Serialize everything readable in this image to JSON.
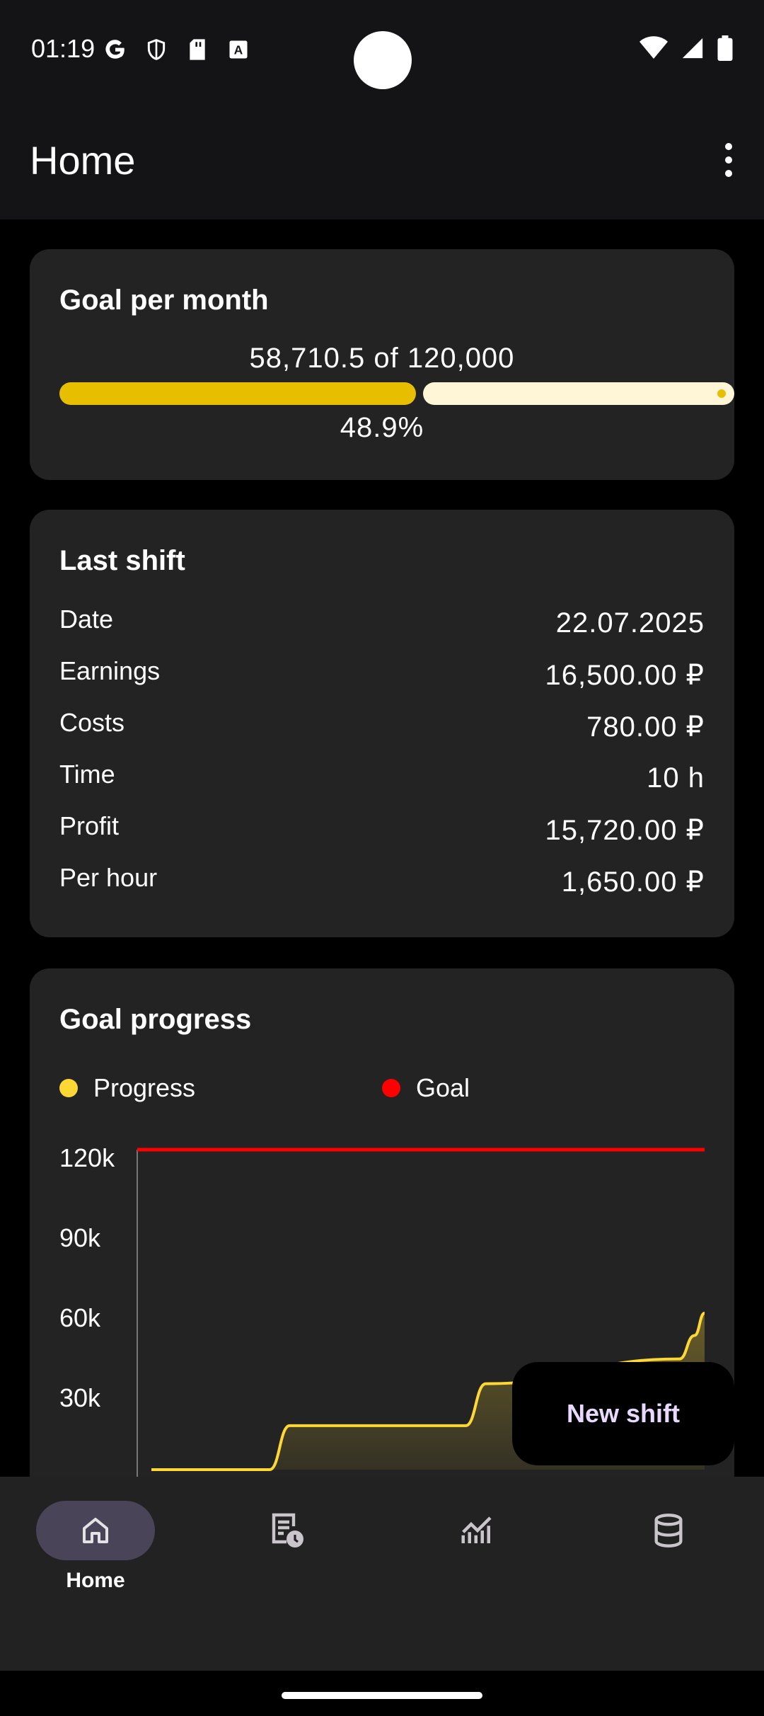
{
  "status_bar": {
    "time": "01:19",
    "left_icons": [
      "google-icon",
      "shield-icon",
      "sd-card-icon",
      "keyboard-a-icon"
    ],
    "right_icons": [
      "wifi-icon",
      "signal-icon",
      "battery-icon"
    ]
  },
  "app_bar": {
    "title": "Home",
    "menu_icon": "more-vert-icon"
  },
  "goal_card": {
    "title": "Goal per month",
    "amount_text": "58,710.5 of 120,000",
    "progress_fraction": 0.489,
    "percent_text": "48.9%",
    "colors": {
      "filled": "#e8bf00",
      "rest": "#fff6d7"
    }
  },
  "last_shift": {
    "title": "Last shift",
    "rows": [
      {
        "label": "Date",
        "value": "22.07.2025"
      },
      {
        "label": "Earnings",
        "value": "16,500.00 ₽"
      },
      {
        "label": "Costs",
        "value": "780.00 ₽"
      },
      {
        "label": "Time",
        "value": "10 h"
      },
      {
        "label": "Profit",
        "value": "15,720.00 ₽"
      },
      {
        "label": "Per hour",
        "value": "1,650.00 ₽"
      }
    ]
  },
  "goal_progress": {
    "title": "Goal progress",
    "legend": [
      {
        "label": "Progress",
        "color": "#fdd835"
      },
      {
        "label": "Goal",
        "color": "#ff0000"
      }
    ]
  },
  "chart_data": {
    "type": "line",
    "title": "Goal progress",
    "ylim": [
      0,
      120000
    ],
    "yticks": [
      120000,
      90000,
      60000,
      30000
    ],
    "ytick_labels": [
      "120k",
      "90k",
      "60k",
      "30k"
    ],
    "xlim": [
      0,
      22
    ],
    "grid": false,
    "legend_position": "top",
    "series": [
      {
        "name": "Progress",
        "color": "#fdd835",
        "fill": true,
        "x": [
          0,
          4.7,
          5.5,
          12.5,
          13.3,
          21.0,
          21.6,
          22.0
        ],
        "y": [
          0,
          0,
          16500,
          16500,
          32220,
          41500,
          50300,
          58710.5
        ]
      },
      {
        "name": "Goal",
        "color": "#ff0000",
        "x": [
          0,
          22
        ],
        "y": [
          120000,
          120000
        ]
      }
    ]
  },
  "fab": {
    "label": "New shift"
  },
  "bottom_nav": {
    "items": [
      {
        "icon": "home-icon",
        "label": "Home",
        "active": true
      },
      {
        "icon": "shift-history-icon",
        "label": "",
        "active": false
      },
      {
        "icon": "statistics-icon",
        "label": "",
        "active": false
      },
      {
        "icon": "database-icon",
        "label": "",
        "active": false
      }
    ]
  }
}
